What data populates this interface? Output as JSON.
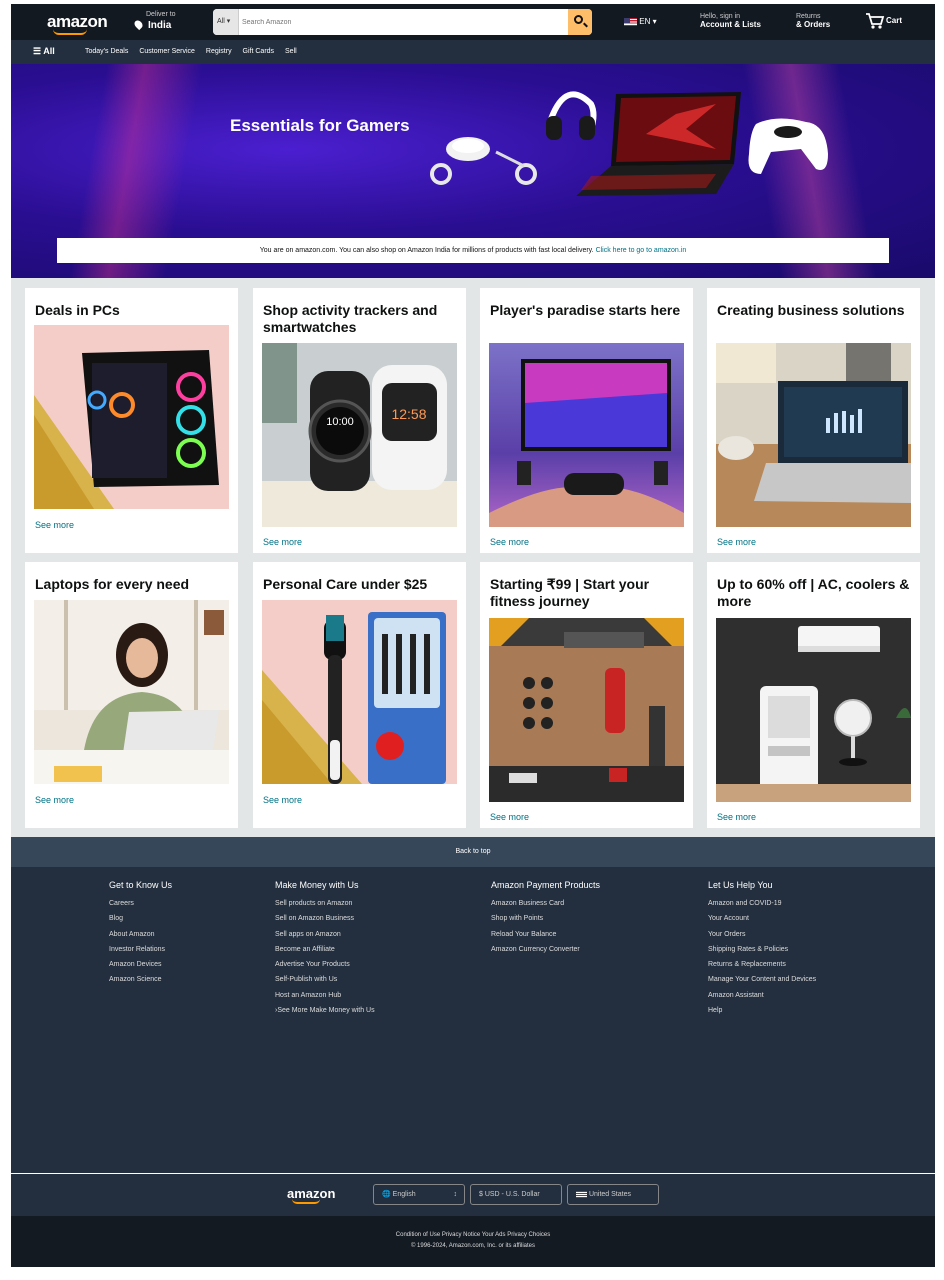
{
  "header": {
    "logo": "amazon",
    "deliver_label": "Deliver to",
    "deliver_location": "India",
    "search_category": "All",
    "search_placeholder": "Search Amazon",
    "language": "EN",
    "account_line1": "Hello, sign in",
    "account_line2": "Account & Lists",
    "returns_line1": "Returns",
    "returns_line2": "& Orders",
    "cart_label": "Cart"
  },
  "subnav": {
    "all_label": "All",
    "links": [
      "Today's Deals",
      "Customer Service",
      "Registry",
      "Gift Cards",
      "Sell"
    ]
  },
  "hero": {
    "title": "Essentials for Gamers",
    "notice_text": "You are on amazon.com. You can also shop on Amazon India for millions of products with fast local delivery.",
    "notice_link": "Click here to go to amazon.in"
  },
  "cards": [
    {
      "title": "Deals in PCs",
      "link": "See more"
    },
    {
      "title": "Shop activity trackers and smartwatches",
      "link": "See more"
    },
    {
      "title": "Player's paradise starts here",
      "link": "See more"
    },
    {
      "title": "Creating business solutions",
      "link": "See more"
    },
    {
      "title": "Laptops for every need",
      "link": "See more"
    },
    {
      "title": "Personal Care under $25",
      "link": "See more"
    },
    {
      "title": "Starting ₹99 | Start your fitness journey",
      "link": "See more"
    },
    {
      "title": "Up to 60% off | AC, coolers & more",
      "link": "See more"
    }
  ],
  "watch_faces": {
    "left": "10:00",
    "right": "12:58"
  },
  "footer": {
    "back_to_top": "Back to top",
    "columns": [
      {
        "heading": "Get to Know Us",
        "items": [
          "Careers",
          "Blog",
          "About Amazon",
          "Investor Relations",
          "Amazon Devices",
          "Amazon Science"
        ]
      },
      {
        "heading": "Make Money with Us",
        "items": [
          "Sell products on Amazon",
          "Sell on Amazon Business",
          "Sell apps on Amazon",
          "Become an Affiliate",
          "Advertise Your Products",
          "Self-Publish with Us",
          "Host an Amazon Hub",
          "›See More Make Money with Us"
        ]
      },
      {
        "heading": "Amazon Payment Products",
        "items": [
          "Amazon Business Card",
          "Shop with Points",
          "Reload Your Balance",
          "Amazon Currency Converter"
        ]
      },
      {
        "heading": "Let Us Help You",
        "items": [
          "Amazon and COVID-19",
          "Your Account",
          "Your Orders",
          "Shipping Rates & Policies",
          "Returns & Replacements",
          "Manage Your Content and Devices",
          "Amazon Assistant",
          "Help"
        ]
      }
    ],
    "logo": "amazon",
    "language_btn": "English",
    "currency_btn": "$  USD - U.S. Dollar",
    "country_btn": "United States",
    "legal_links": "Condition of Use  Privacy Notice  Your Ads Privacy Choices",
    "copyright": "© 1996-2024, Amazon.com, Inc. or its affiliates"
  },
  "colors": {
    "nav_bg": "#131921",
    "subnav_bg": "#232f3e",
    "search_button": "#febd69",
    "link": "#007185",
    "accent": "#ff9900",
    "footer_bg": "#232f3e",
    "back_to_top_bg": "#37475a",
    "bottom_bg": "#131a22"
  }
}
